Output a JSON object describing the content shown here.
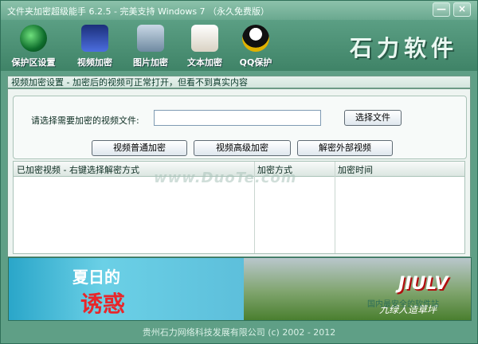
{
  "title": "文件夹加密超级能手 6.2.5 - 完美支持 Windows 7 （永久免费版）",
  "window_controls": {
    "minimize": "—",
    "close": "×"
  },
  "toolbar": {
    "items": [
      {
        "label": "保护区设置",
        "icon": "protect-zone-icon"
      },
      {
        "label": "视频加密",
        "icon": "video-clapper-icon"
      },
      {
        "label": "图片加密",
        "icon": "photo-icon"
      },
      {
        "label": "文本加密",
        "icon": "document-icon"
      },
      {
        "label": "QQ保护",
        "icon": "qq-penguin-icon"
      }
    ],
    "brand": "石力软件"
  },
  "section_title": "视频加密设置 - 加密后的视频可正常打开，但看不到真实内容",
  "file_select": {
    "label": "请选择需要加密的视频文件:",
    "value": "",
    "choose_button": "选择文件"
  },
  "actions": {
    "normal": "视频普通加密",
    "advanced": "视频高级加密",
    "decrypt_external": "解密外部视频"
  },
  "list": {
    "columns": [
      "已加密视频 - 右键选择解密方式",
      "加密方式",
      "加密时间"
    ],
    "rows": [],
    "watermark": "www.DuoTe.com"
  },
  "banner": {
    "left_text_1": "夏日的",
    "left_text_2": "诱惑",
    "right_logo": "JIULV",
    "right_caption": "九绿人造草坪",
    "site_caption": "国内最安全的软件站"
  },
  "footer": "贵州石力网络科技发展有限公司 (c) 2002 - 2012",
  "colors": {
    "frame": "#5f9f86",
    "toolbar": "#3f8367",
    "accent_red": "#e8262a"
  }
}
